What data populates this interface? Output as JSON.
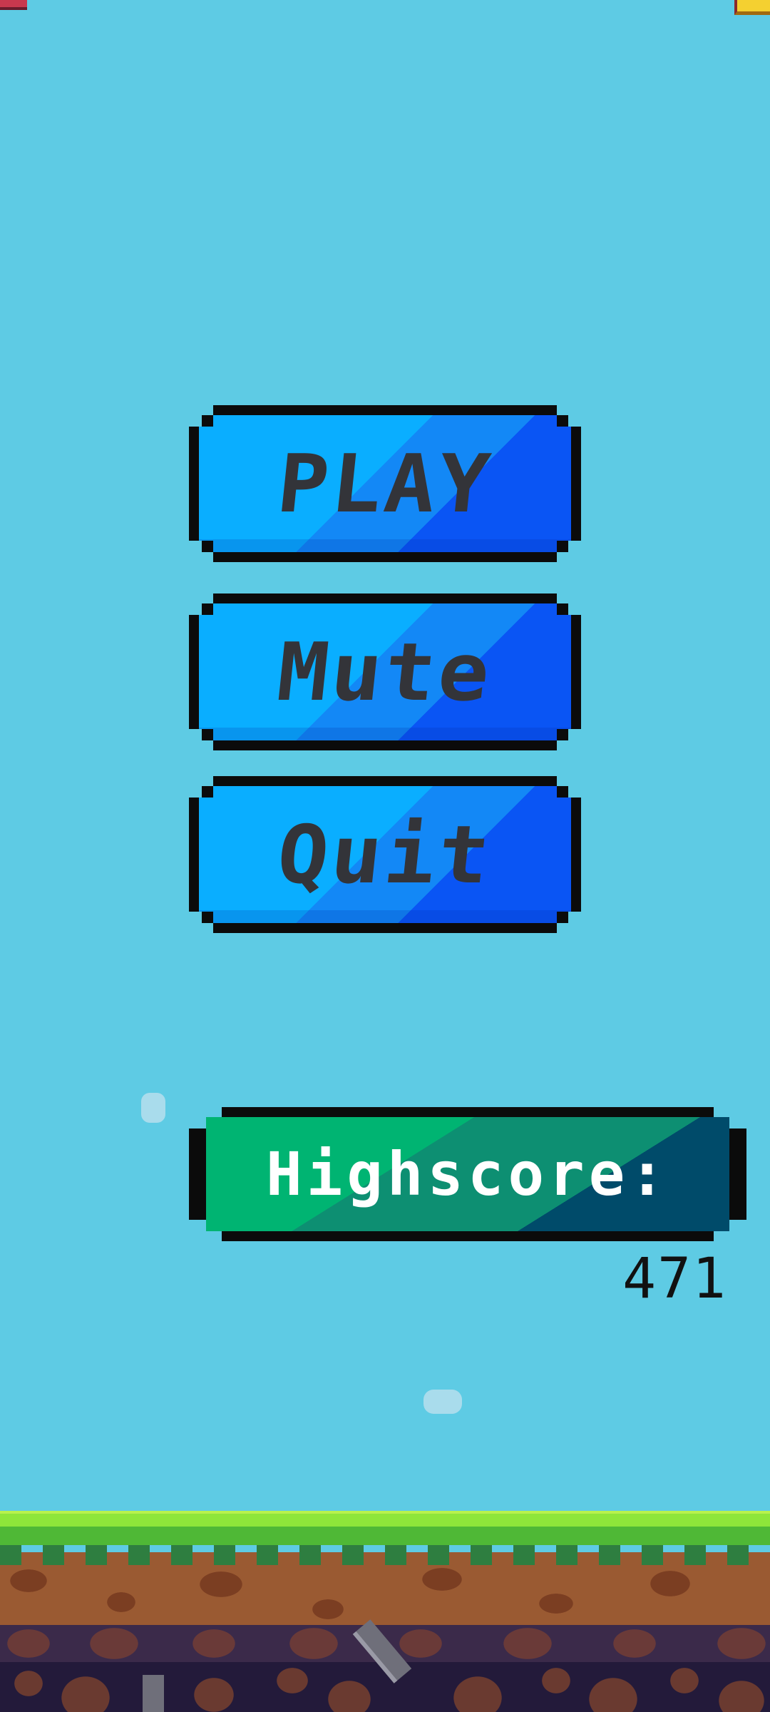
{
  "menu": {
    "play_label": "PLAY",
    "mute_label": "Mute",
    "quit_label": "Quit"
  },
  "highscore": {
    "label": "Highscore:",
    "value": "471"
  },
  "colors": {
    "sky": "#5ecbe4",
    "button_light": "#0aaeff",
    "button_dark": "#0a55f4",
    "banner_green": "#00b472",
    "banner_dark": "#004b6a",
    "outline": "#0b0b0b",
    "button_text": "#333439"
  }
}
